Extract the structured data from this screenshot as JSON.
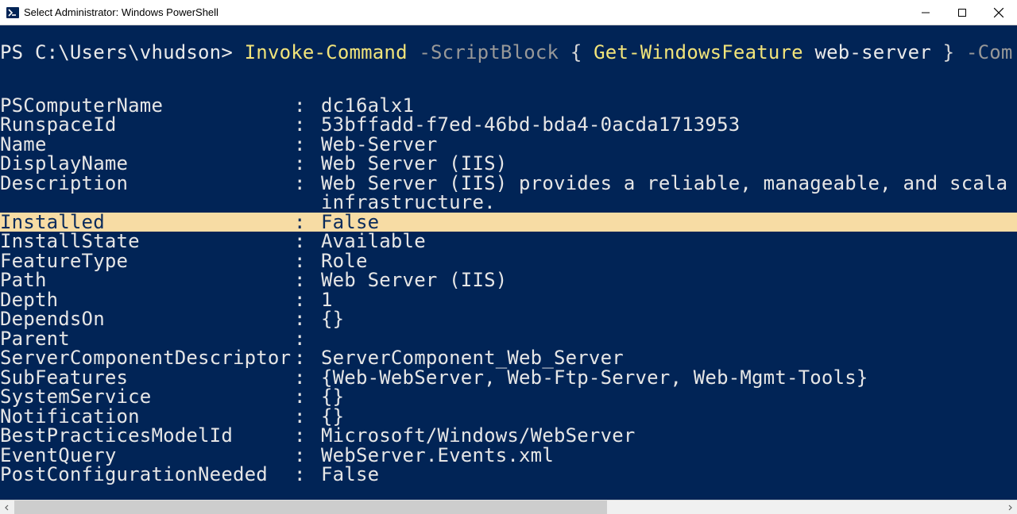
{
  "window": {
    "title": "Select Administrator: Windows PowerShell"
  },
  "prompt": {
    "ps": "PS ",
    "path": "C:\\Users\\vhudson",
    "gt": "> ",
    "cmd1": "Invoke-Command",
    "flag1": " -ScriptBlock ",
    "brace_open": "{ ",
    "cmd2": "Get-WindowsFeature",
    "arg": " web-server ",
    "brace_close": "} ",
    "flag2": "-Com"
  },
  "output": [
    {
      "key": "PSComputerName",
      "val": "dc16alx1"
    },
    {
      "key": "RunspaceId",
      "val": "53bffadd-f7ed-46bd-bda4-0acda1713953"
    },
    {
      "key": "Name",
      "val": "Web-Server"
    },
    {
      "key": "DisplayName",
      "val": "Web Server (IIS)"
    },
    {
      "key": "Description",
      "val": "Web Server (IIS) provides a reliable, manageable, and scala",
      "cont": "infrastructure."
    },
    {
      "key": "Installed",
      "val": "False",
      "highlight": true
    },
    {
      "key": "InstallState",
      "val": "Available"
    },
    {
      "key": "FeatureType",
      "val": "Role"
    },
    {
      "key": "Path",
      "val": "Web Server (IIS)"
    },
    {
      "key": "Depth",
      "val": "1"
    },
    {
      "key": "DependsOn",
      "val": "{}"
    },
    {
      "key": "Parent",
      "val": ""
    },
    {
      "key": "ServerComponentDescriptor",
      "val": "ServerComponent_Web_Server"
    },
    {
      "key": "SubFeatures",
      "val": "{Web-WebServer, Web-Ftp-Server, Web-Mgmt-Tools}"
    },
    {
      "key": "SystemService",
      "val": "{}"
    },
    {
      "key": "Notification",
      "val": "{}"
    },
    {
      "key": "BestPracticesModelId",
      "val": "Microsoft/Windows/WebServer"
    },
    {
      "key": "EventQuery",
      "val": "WebServer.Events.xml"
    },
    {
      "key": "PostConfigurationNeeded",
      "val": "False"
    }
  ]
}
